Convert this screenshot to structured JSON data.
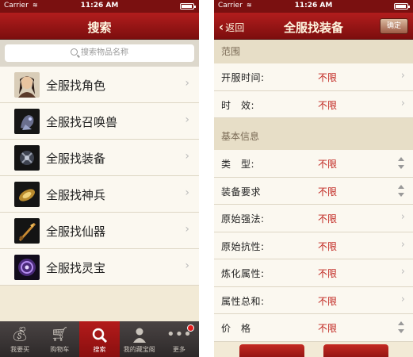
{
  "left": {
    "status": {
      "carrier": "Carrier",
      "time": "11:26 AM"
    },
    "nav_title": "搜索",
    "search": {
      "placeholder": "搜索物品名称"
    },
    "rows": [
      {
        "label": "全服找角色",
        "icon": "character-avatar"
      },
      {
        "label": "全服找召唤兽",
        "icon": "summon-beast"
      },
      {
        "label": "全服找装备",
        "icon": "equipment"
      },
      {
        "label": "全服找神兵",
        "icon": "divine-weapon"
      },
      {
        "label": "全服找仙器",
        "icon": "immortal-artifact"
      },
      {
        "label": "全服找灵宝",
        "icon": "spirit-treasure"
      }
    ],
    "tabs": [
      {
        "label": "我要买",
        "icon": "money-bag-icon"
      },
      {
        "label": "购物车",
        "icon": "cart-icon"
      },
      {
        "label": "搜索",
        "icon": "search-icon",
        "active": true
      },
      {
        "label": "我的藏宝阁",
        "icon": "user-icon"
      },
      {
        "label": "更多",
        "icon": "more-icon",
        "badge": true
      }
    ]
  },
  "right": {
    "status": {
      "carrier": "Carrier",
      "time": "11:26 AM"
    },
    "back_label": "返回",
    "nav_title": "全服找装备",
    "confirm_label": "确定",
    "sections": [
      {
        "title": "范围",
        "rows": [
          {
            "label": "开服时间:",
            "value": "不限",
            "control": "chevron"
          },
          {
            "label": "时　效:",
            "value": "不限",
            "control": "chevron"
          }
        ]
      },
      {
        "title": "基本信息",
        "rows": [
          {
            "label": "类　型:",
            "value": "不限",
            "control": "stepper"
          },
          {
            "label": "装备要求",
            "value": "不限",
            "control": "stepper"
          },
          {
            "label": "原始强法:",
            "value": "不限",
            "control": "chevron"
          },
          {
            "label": "原始抗性:",
            "value": "不限",
            "control": "chevron"
          },
          {
            "label": "炼化属性:",
            "value": "不限",
            "control": "chevron"
          },
          {
            "label": "属性总和:",
            "value": "不限",
            "control": "chevron"
          },
          {
            "label": "价　格",
            "value": "不限",
            "control": "stepper"
          }
        ]
      }
    ]
  },
  "colors": {
    "brand_red": "#9e1515",
    "value_red": "#c0251f",
    "cream": "#f2ead6"
  }
}
